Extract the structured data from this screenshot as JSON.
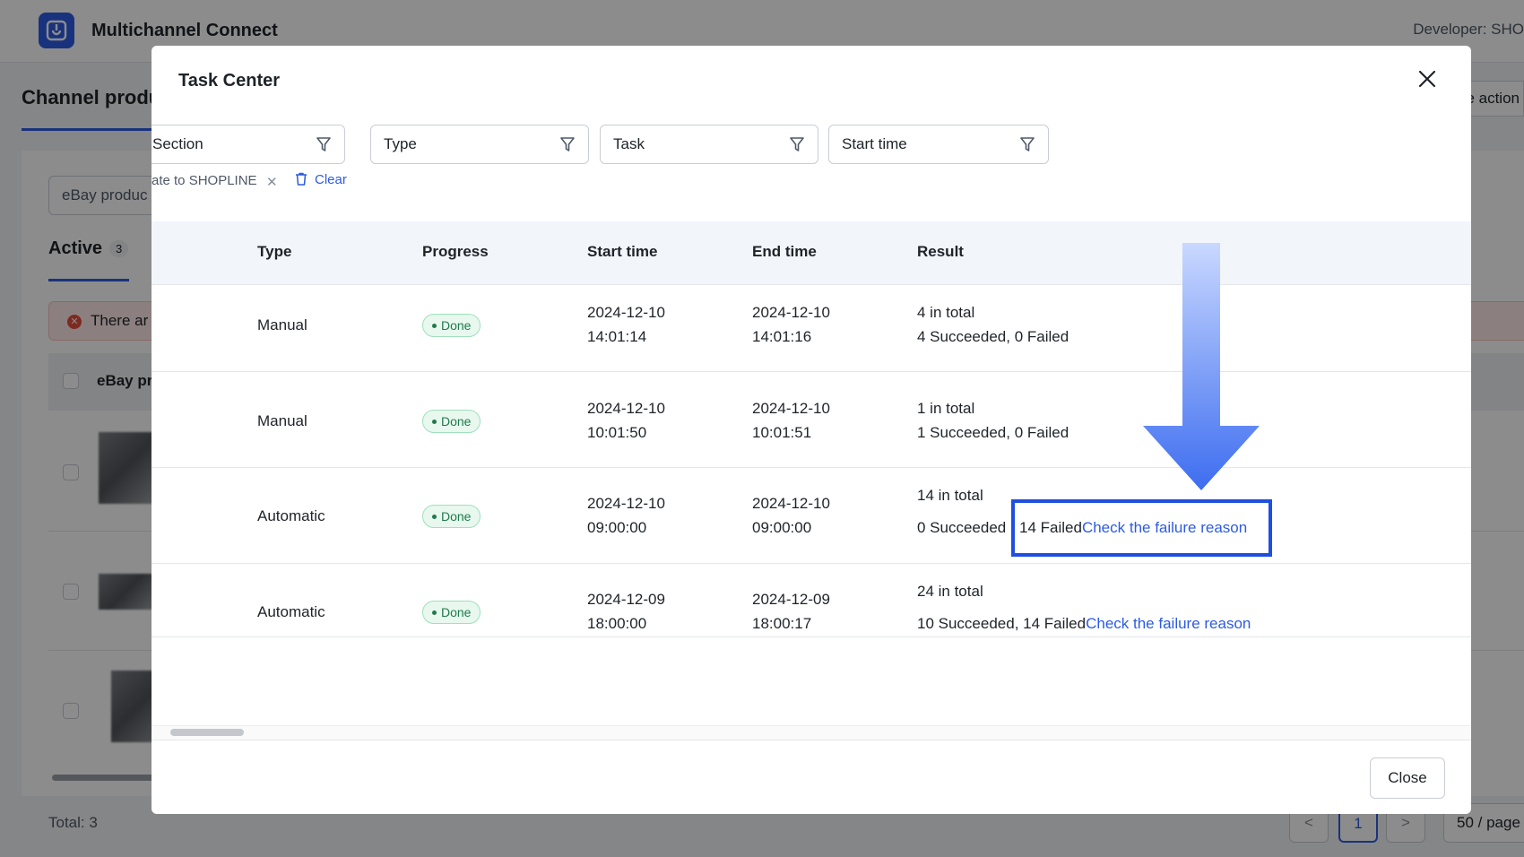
{
  "app": {
    "name": "Multichannel Connect",
    "developer": "Developer: SHO",
    "colors": {
      "brand": "#2d5be3",
      "success": "#1f7a4a",
      "highlight": "#1f4fe0"
    }
  },
  "background": {
    "page_title": "Channel produ",
    "bulk_action": "e action",
    "search_value": "eBay produc",
    "tab_active": {
      "label": "Active",
      "count": "3"
    },
    "alert_text": "There ar",
    "table_head_label": "eBay pr",
    "total": "Total: 3",
    "pager": {
      "prev": "<",
      "current": "1",
      "next": ">",
      "page_size": "50 / page"
    }
  },
  "modal": {
    "title": "Task Center",
    "filters": [
      {
        "label": "Section",
        "icon": "filter-icon"
      },
      {
        "label": "Type",
        "icon": "filter-icon"
      },
      {
        "label": "Task",
        "icon": "filter-icon"
      },
      {
        "label": "Start time",
        "icon": "filter-icon"
      }
    ],
    "active_chip": "ate to SHOPLINE",
    "clear_label": "Clear",
    "columns": [
      "Type",
      "Progress",
      "Start time",
      "End time",
      "Result"
    ],
    "rows": [
      {
        "type": "Manual",
        "progress": "Done",
        "start_date": "2024-12-10",
        "start_time": "14:01:14",
        "end_date": "2024-12-10",
        "end_time": "14:01:16",
        "total": "4 in total",
        "summary": "4 Succeeded, 0 Failed",
        "link": ""
      },
      {
        "type": "Manual",
        "progress": "Done",
        "start_date": "2024-12-10",
        "start_time": "10:01:50",
        "end_date": "2024-12-10",
        "end_time": "10:01:51",
        "total": "1 in total",
        "summary": "1 Succeeded, 0 Failed",
        "link": ""
      },
      {
        "type": "Automatic",
        "progress": "Done",
        "start_date": "2024-12-10",
        "start_time": "09:00:00",
        "end_date": "2024-12-10",
        "end_time": "09:00:00",
        "total": "14 in total",
        "summary_a": "0 Succeeded",
        "summary_b": "14 Failed",
        "link": "Check the failure reason"
      },
      {
        "type": "Automatic",
        "progress": "Done",
        "start_date": "2024-12-09",
        "start_time": "18:00:00",
        "end_date": "2024-12-09",
        "end_time": "18:00:17",
        "total": "24 in total",
        "summary": "10 Succeeded, 14 Failed",
        "link": "Check the failure reason"
      }
    ],
    "close_label": "Close"
  }
}
